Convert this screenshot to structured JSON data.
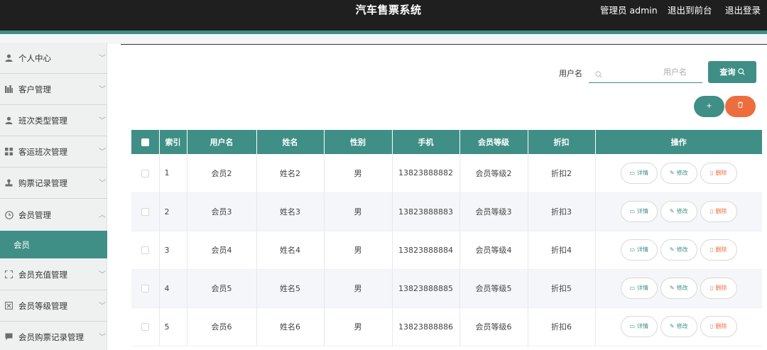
{
  "header": {
    "title": "汽车售票系统",
    "admin": "管理员 admin",
    "to_front": "退出到前台",
    "logout": "退出登录"
  },
  "sidebar": {
    "items": [
      {
        "label": "个人中心",
        "icon": "person-icon"
      },
      {
        "label": "客户管理",
        "icon": "bar-chart-icon"
      },
      {
        "label": "班次类型管理",
        "icon": "person-icon"
      },
      {
        "label": "客运班次管理",
        "icon": "grid-icon"
      },
      {
        "label": "购票记录管理",
        "icon": "stamp-icon"
      },
      {
        "label": "会员管理",
        "icon": "clock-icon",
        "expanded": true
      },
      {
        "label": "会员充值管理",
        "icon": "frame-icon"
      },
      {
        "label": "会员等级管理",
        "icon": "doc-x-icon"
      },
      {
        "label": "会员购票记录管理",
        "icon": "chat-icon"
      }
    ],
    "active_sub": "会员"
  },
  "search": {
    "label": "用户名",
    "placeholder": "用户名",
    "query_button": "查询"
  },
  "actions": {
    "add": "+",
    "delete": "🗑"
  },
  "table": {
    "headers": [
      "",
      "索引",
      "用户名",
      "姓名",
      "性别",
      "手机",
      "会员等级",
      "折扣",
      "操作"
    ],
    "op_labels": {
      "detail": "详情",
      "edit": "修改",
      "delete": "删除"
    },
    "rows": [
      {
        "index": "1",
        "username": "会员2",
        "name": "姓名2",
        "gender": "男",
        "phone": "13823888882",
        "level": "会员等级2",
        "discount": "折扣2"
      },
      {
        "index": "2",
        "username": "会员3",
        "name": "姓名3",
        "gender": "男",
        "phone": "13823888883",
        "level": "会员等级3",
        "discount": "折扣3"
      },
      {
        "index": "3",
        "username": "会员4",
        "name": "姓名4",
        "gender": "男",
        "phone": "13823888884",
        "level": "会员等级4",
        "discount": "折扣4"
      },
      {
        "index": "4",
        "username": "会员5",
        "name": "姓名5",
        "gender": "男",
        "phone": "13823888885",
        "level": "会员等级5",
        "discount": "折扣5"
      },
      {
        "index": "5",
        "username": "会员6",
        "name": "姓名6",
        "gender": "男",
        "phone": "13823888886",
        "level": "会员等级6",
        "discount": "折扣6"
      }
    ]
  },
  "colors": {
    "accent": "#3f8f86",
    "danger": "#ed6d3e",
    "topbar": "#1f1f1f"
  }
}
